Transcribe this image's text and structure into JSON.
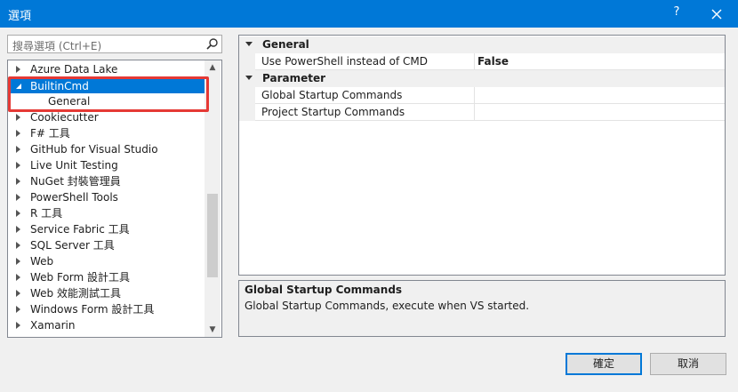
{
  "window": {
    "title": "選項",
    "help_label": "?"
  },
  "search": {
    "placeholder": "搜尋選項 (Ctrl+E)"
  },
  "tree": {
    "items": [
      {
        "label": "Azure Data Lake",
        "expanded": false
      },
      {
        "label": "BuiltinCmd",
        "expanded": true,
        "selected": true
      },
      {
        "label": "General",
        "child": true
      },
      {
        "label": "Cookiecutter",
        "expanded": false
      },
      {
        "label": "F# 工具",
        "expanded": false
      },
      {
        "label": "GitHub for Visual Studio",
        "expanded": false
      },
      {
        "label": "Live Unit Testing",
        "expanded": false
      },
      {
        "label": "NuGet 封裝管理員",
        "expanded": false
      },
      {
        "label": "PowerShell Tools",
        "expanded": false
      },
      {
        "label": "R 工具",
        "expanded": false
      },
      {
        "label": "Service Fabric 工具",
        "expanded": false
      },
      {
        "label": "SQL Server 工具",
        "expanded": false
      },
      {
        "label": "Web",
        "expanded": false
      },
      {
        "label": "Web Form 設計工具",
        "expanded": false
      },
      {
        "label": "Web 效能測試工具",
        "expanded": false
      },
      {
        "label": "Windows Form 設計工具",
        "expanded": false
      },
      {
        "label": "Xamarin",
        "expanded": false
      }
    ]
  },
  "grid": {
    "categories": [
      {
        "name": "General",
        "props": [
          {
            "name": "Use PowerShell instead of CMD",
            "value": "False"
          }
        ]
      },
      {
        "name": "Parameter",
        "props": [
          {
            "name": "Global Startup Commands",
            "value": ""
          },
          {
            "name": "Project Startup Commands",
            "value": ""
          }
        ]
      }
    ]
  },
  "description": {
    "title": "Global Startup Commands",
    "text": "Global Startup Commands, execute when VS started."
  },
  "buttons": {
    "ok": "確定",
    "cancel": "取消"
  },
  "colors": {
    "accent": "#0078d7",
    "highlight": "#e53935"
  }
}
